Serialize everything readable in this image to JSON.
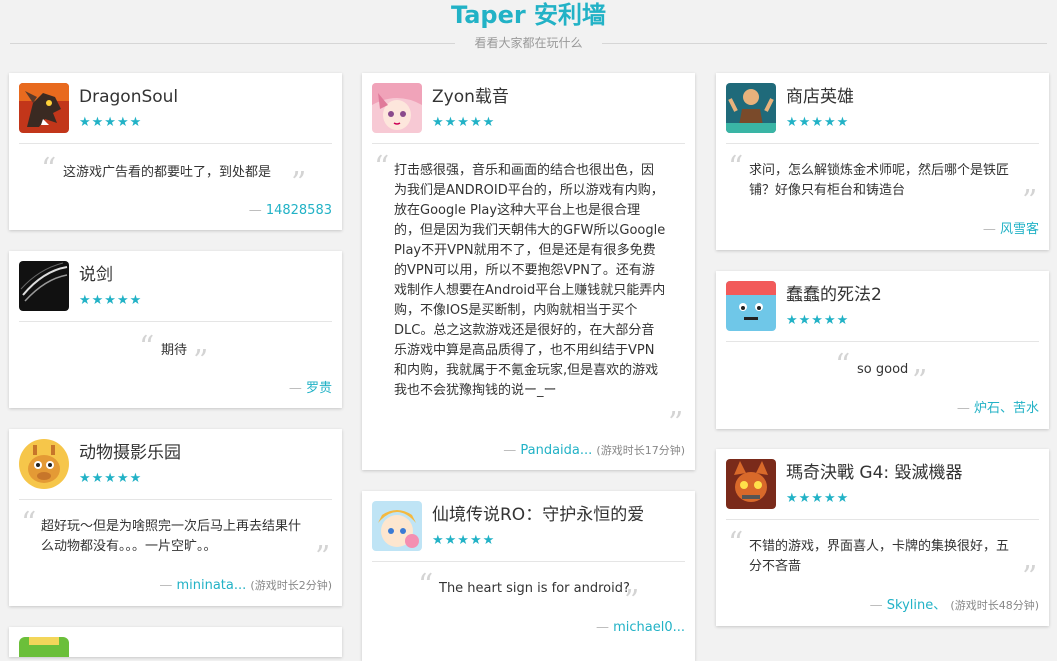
{
  "page": {
    "title": "Taper 安利墙",
    "subtitle": "看看大家都在玩什么"
  },
  "colors": {
    "accent": "#22b2c6",
    "background": "#f2f2f2"
  },
  "cards": [
    {
      "app_name": "DragonSoul",
      "rating": "5/5",
      "stars": "★★★★★",
      "review": "这游戏广告看的都要吐了，到处都是",
      "author": "14828583",
      "playtime": "",
      "icon": "dragon-app-icon"
    },
    {
      "app_name": "说剑",
      "rating": "5/5",
      "stars": "★★★★★",
      "review": "期待",
      "author": "罗贵",
      "playtime": "",
      "icon": "sword-app-icon"
    },
    {
      "app_name": "动物摄影乐园",
      "rating": "5/5",
      "stars": "★★★★★",
      "review": "超好玩～但是为啥照完一次后马上再去结果什么动物都没有。。。一片空旷。。",
      "author": "mininata...",
      "playtime": "(游戏时长2分钟)",
      "icon": "giraffe-app-icon"
    },
    {
      "app_name": "Zyon载音",
      "rating": "5/5",
      "stars": "★★★★★",
      "review": "打击感很强，音乐和画面的结合也很出色，因为我们是ANDROID平台的，所以游戏有内购，放在Google Play这种大平台上也是很合理的，但是因为我们天朝伟大的GFW所以Google Play不开VPN就用不了，但是还是有很多免费的VPN可以用，所以不要抱怨VPN了。还有游戏制作人想要在Android平台上赚钱就只能弄内购，不像IOS是买断制，内购就相当于买个DLC。总之这款游戏还是很好的，在大部分音乐游戏中算是高品质得了，也不用纠结于VPN和内购，我就属于不氪金玩家,但是喜欢的游戏我也不会犹豫掏钱的说ー_ー",
      "author": "Pandaida...",
      "playtime": "(游戏时长17分钟)",
      "icon": "anime-girl-app-icon"
    },
    {
      "app_name": "仙境传说RO：守护永恒的爱",
      "rating": "5/5",
      "stars": "★★★★★",
      "review": "The heart sign is for android?",
      "author": "michael0...",
      "playtime": "",
      "icon": "ragnarok-app-icon"
    },
    {
      "app_name": "商店英雄",
      "rating": "5/5",
      "stars": "★★★★★",
      "review": "求问，怎么解锁炼金术师呢，然后哪个是铁匠铺？好像只有柜台和铸造台",
      "author": "风雪客",
      "playtime": "",
      "icon": "hero-app-icon"
    },
    {
      "app_name": "蠢蠢的死法2",
      "rating": "5/5",
      "stars": "★★★★★",
      "review": "so good",
      "author": "炉石、苦水",
      "playtime": "",
      "icon": "dumb-ways-app-icon"
    },
    {
      "app_name": "瑪奇決戰 G4: 毀滅機器",
      "rating": "5/5",
      "stars": "★★★★★",
      "review": "不错的游戏，界面喜人，卡牌的集换很好，五分不吝啬",
      "author": "Skyline、",
      "playtime": "(游戏时长48分钟)",
      "icon": "robot-cat-app-icon"
    },
    {
      "app_name": "",
      "rating": "",
      "stars": "",
      "review": "",
      "author": "",
      "playtime": "",
      "icon": "partial-app-icon"
    }
  ]
}
